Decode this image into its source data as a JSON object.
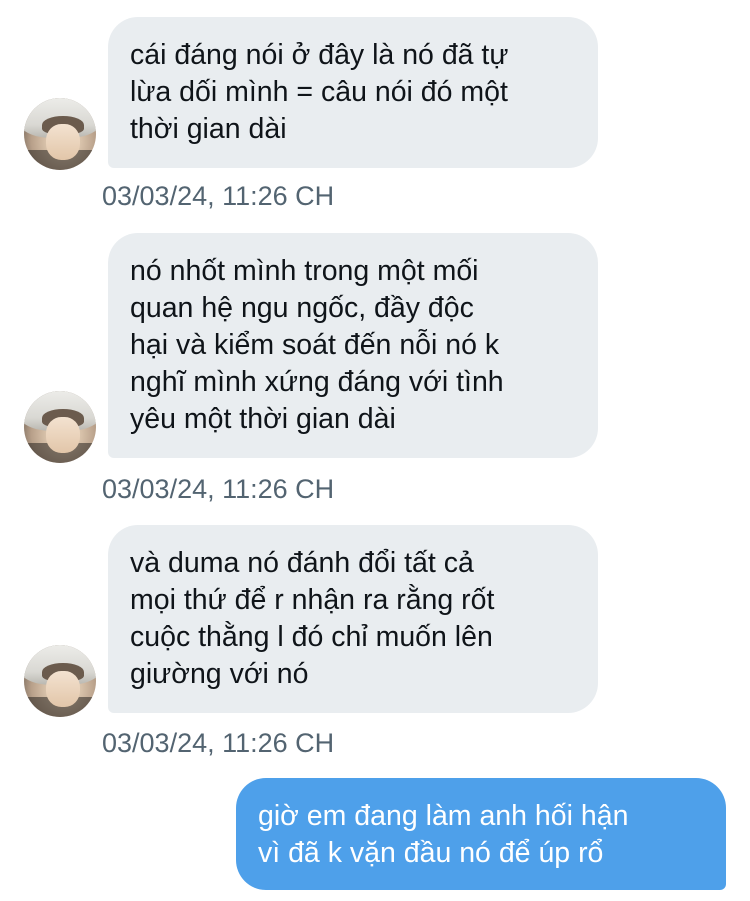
{
  "thread": {
    "messages": [
      {
        "direction": "incoming",
        "text": "cái đáng nói ở đây là nó đã tự\nlừa dối mình = câu nói đó một\nthời gian dài",
        "timestamp": "03/03/24, 11:26 CH"
      },
      {
        "direction": "incoming",
        "text": "nó nhốt mình trong một mối\nquan hệ ngu ngốc, đầy độc\nhại và kiểm soát đến nỗi nó k\nnghĩ mình xứng đáng với tình\nyêu một thời gian dài",
        "timestamp": "03/03/24, 11:26 CH"
      },
      {
        "direction": "incoming",
        "text": "và duma nó đánh đổi tất cả\nmọi thứ để r nhận ra rằng rốt\ncuộc thằng l đó chỉ muốn lên\ngiường với nó",
        "timestamp": "03/03/24, 11:26 CH"
      },
      {
        "direction": "outgoing",
        "text": "giờ em đang làm anh hối hận\nvì đã k vặn đầu nó để úp rổ"
      }
    ]
  },
  "colors": {
    "incoming_bubble": "#e9edf0",
    "incoming_text": "#0f1419",
    "outgoing_bubble": "#4ea0ea",
    "outgoing_text": "#ffffff",
    "timestamp_text": "#536471"
  },
  "icons": {
    "avatar": "user-avatar-photo"
  }
}
